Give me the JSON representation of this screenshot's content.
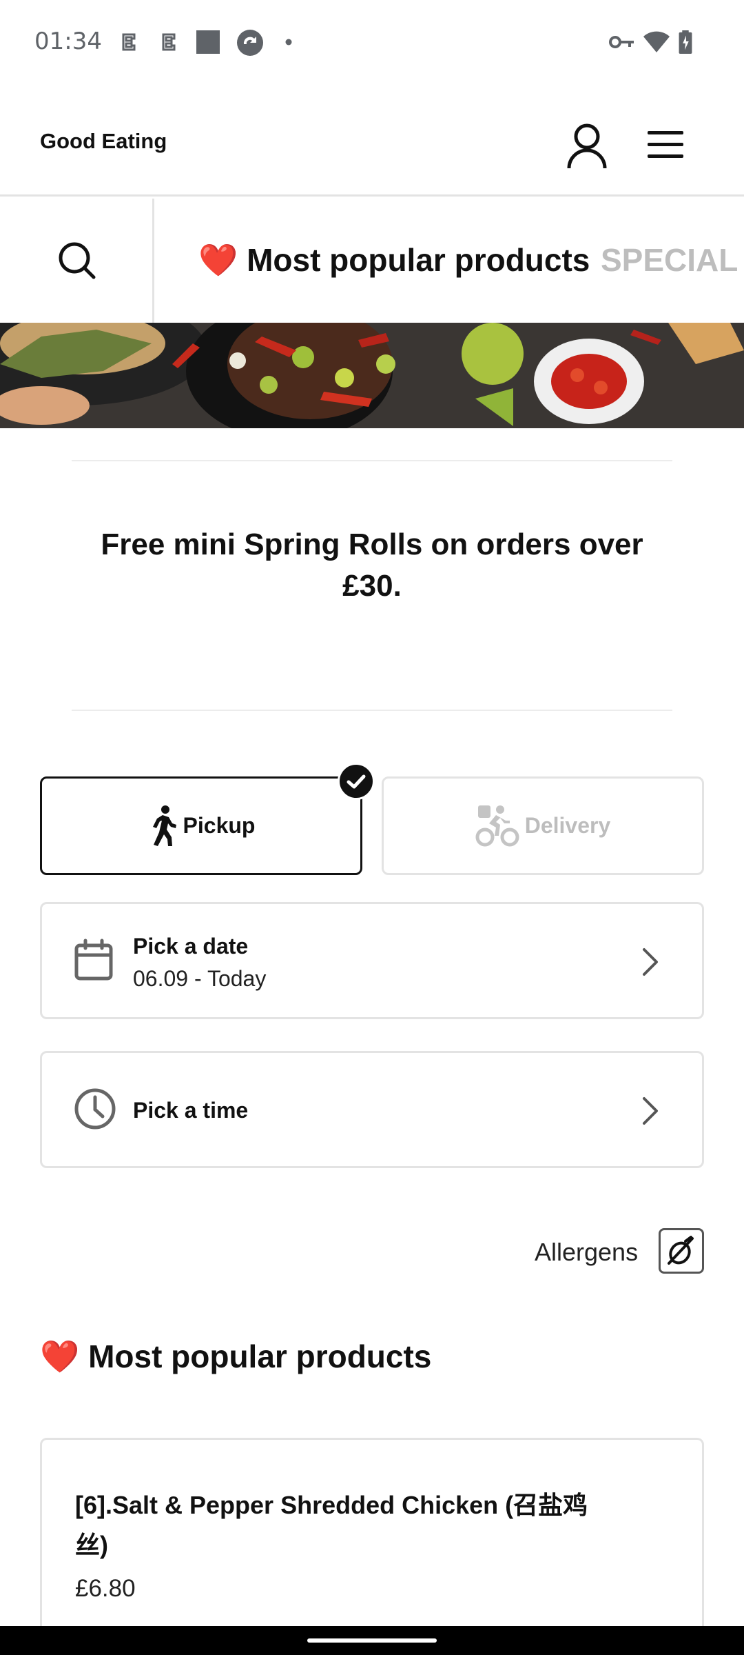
{
  "status_bar": {
    "time": "01:34",
    "left_icons": [
      "notification-app-icon",
      "notification-app-icon",
      "notification-square-icon",
      "notification-sync-icon",
      "notification-dot-icon"
    ],
    "right_icons": [
      "vpn-key-icon",
      "wifi-icon",
      "battery-charging-icon"
    ]
  },
  "header": {
    "brand": "Good Eating",
    "account_icon": "user-icon",
    "menu_icon": "hamburger-menu-icon"
  },
  "category_bar": {
    "search_icon": "search-icon",
    "tabs": [
      {
        "emoji": "❤️",
        "label": "Most popular products",
        "active": true
      },
      {
        "emoji": "",
        "label": "SPECIAL S",
        "active": false
      }
    ]
  },
  "promo": {
    "text": "Free mini Spring Rolls on orders over £30."
  },
  "fulfilment": {
    "pickup_label": "Pickup",
    "delivery_label": "Delivery",
    "selected": "Pickup"
  },
  "date_picker": {
    "title": "Pick a date",
    "value": "06.09 - Today"
  },
  "time_picker": {
    "title": "Pick a time"
  },
  "allergens": {
    "label": "Allergens"
  },
  "section": {
    "emoji": "❤️",
    "title": "Most popular products"
  },
  "products": [
    {
      "name": "[6].Salt & Pepper Shredded Chicken (召盐鸡丝)",
      "price": "£6.80"
    }
  ],
  "colors": {
    "accent": "#111111",
    "heart": "#e0302e",
    "muted": "#bdbdbd",
    "border": "#e3e3e3"
  }
}
